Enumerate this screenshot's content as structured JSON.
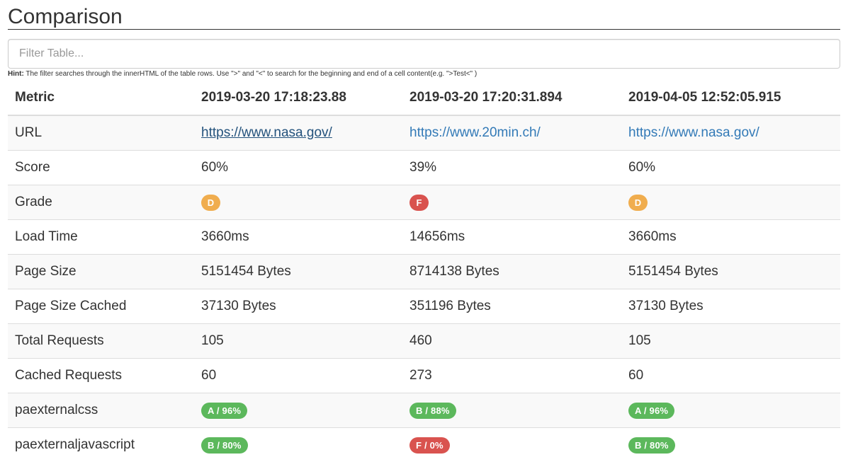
{
  "page": {
    "title": "Comparison",
    "filter_placeholder": "Filter Table...",
    "hint_label": "Hint:",
    "hint_text": " The filter searches through the innerHTML of the table rows. Use \">\" and \"<\" to search for the beginning and end of a cell content(e.g. \">Test<\" )"
  },
  "colors": {
    "orange": "#f0ad4e",
    "red": "#d9534f",
    "green": "#5cb85c",
    "link": "#337ab7"
  },
  "table": {
    "headers": [
      "Metric",
      "2019-03-20 17:18:23.88",
      "2019-03-20 17:20:31.894",
      "2019-04-05 12:52:05.915"
    ],
    "rows": {
      "url": {
        "label": "URL",
        "values": [
          "https://www.nasa.gov/",
          "https://www.20min.ch/",
          "https://www.nasa.gov/"
        ]
      },
      "score": {
        "label": "Score",
        "values": [
          "60%",
          "39%",
          "60%"
        ]
      },
      "grade": {
        "label": "Grade",
        "values": [
          "D",
          "F",
          "D"
        ],
        "colors": [
          "orange",
          "red",
          "orange"
        ]
      },
      "load_time": {
        "label": "Load Time",
        "values": [
          "3660ms",
          "14656ms",
          "3660ms"
        ]
      },
      "page_size": {
        "label": "Page Size",
        "values": [
          "5151454 Bytes",
          "8714138 Bytes",
          "5151454 Bytes"
        ]
      },
      "page_size_cached": {
        "label": "Page Size Cached",
        "values": [
          "37130 Bytes",
          "351196 Bytes",
          "37130 Bytes"
        ]
      },
      "total_requests": {
        "label": "Total Requests",
        "values": [
          "105",
          "460",
          "105"
        ]
      },
      "cached_requests": {
        "label": "Cached Requests",
        "values": [
          "60",
          "273",
          "60"
        ]
      },
      "paexternalcss": {
        "label": "paexternalcss",
        "values": [
          "A / 96%",
          "B / 88%",
          "A / 96%"
        ],
        "colors": [
          "green",
          "green",
          "green"
        ]
      },
      "paexternaljavascript": {
        "label": "paexternaljavascript",
        "values": [
          "B / 80%",
          "F / 0%",
          "B / 80%"
        ],
        "colors": [
          "green",
          "red",
          "green"
        ]
      }
    }
  }
}
